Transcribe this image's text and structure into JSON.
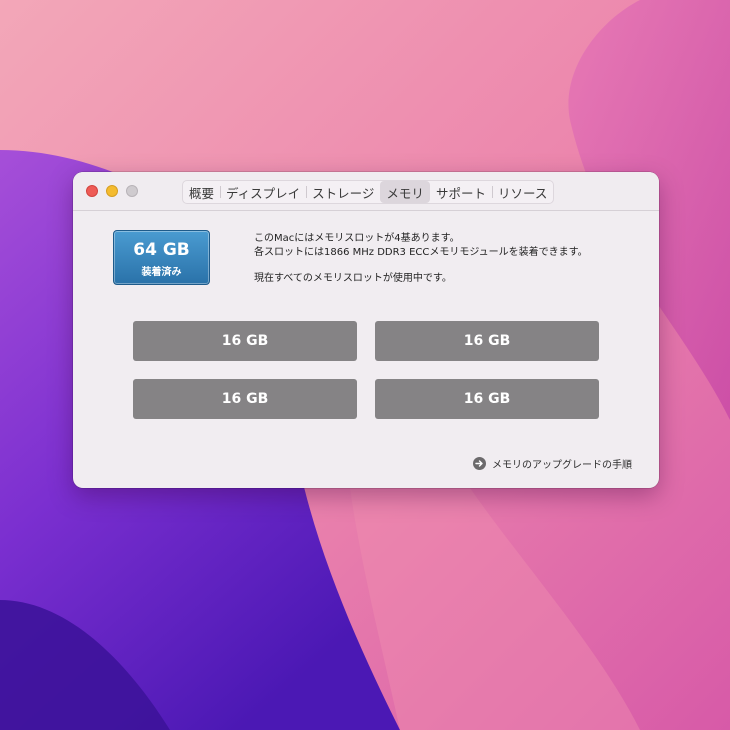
{
  "window": {
    "tabs": [
      {
        "label": "概要",
        "active": false
      },
      {
        "label": "ディスプレイ",
        "active": false
      },
      {
        "label": "ストレージ",
        "active": false
      },
      {
        "label": "メモリ",
        "active": true
      },
      {
        "label": "サポート",
        "active": false
      },
      {
        "label": "リソース",
        "active": false
      }
    ]
  },
  "memory": {
    "total": "64 GB",
    "status": "装着済み",
    "info_line1": "このMacにはメモリスロットが4基あります。",
    "info_line2": "各スロットには1866 MHz DDR3 ECCメモリモジュールを装着できます。",
    "info_line3": "現在すべてのメモリスロットが使用中です。",
    "slots": [
      "16 GB",
      "16 GB",
      "16 GB",
      "16 GB"
    ],
    "upgrade_link": "メモリのアップグレードの手順"
  },
  "colors": {
    "badge_blue": "#2f7fba",
    "slot_gray": "#858385",
    "window_bg": "#f1edf1"
  },
  "icons": {
    "upgrade": "arrow-circle-right-icon"
  }
}
